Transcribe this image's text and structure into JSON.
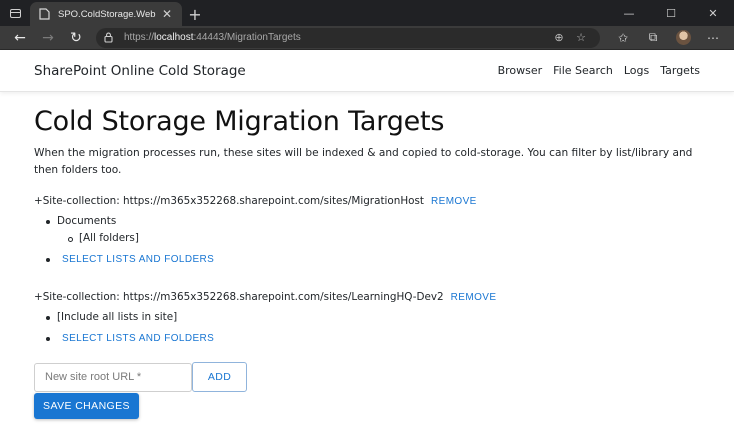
{
  "browser": {
    "tab_title": "SPO.ColdStorage.Web",
    "url_scheme": "https://",
    "url_host": "localhost",
    "url_rest": ":44443/MigrationTargets"
  },
  "navbar": {
    "brand": "SharePoint Online Cold Storage",
    "links": [
      "Browser",
      "File Search",
      "Logs",
      "Targets"
    ]
  },
  "page": {
    "title": "Cold Storage Migration Targets",
    "intro": "When the migration processes run, these sites will be indexed & and copied to cold-storage. You can filter by list/library and then folders too."
  },
  "sites": [
    {
      "label": "+Site-collection: https://m365x352268.sharepoint.com/sites/MigrationHost",
      "remove_label": "REMOVE",
      "list": "Documents",
      "folder": "[All folders]",
      "select_label": "SELECT LISTS AND FOLDERS"
    },
    {
      "label": "+Site-collection: https://m365x352268.sharepoint.com/sites/LearningHQ-Dev2",
      "remove_label": "REMOVE",
      "list": "[Include all lists in site]",
      "select_label": "SELECT LISTS AND FOLDERS"
    }
  ],
  "form": {
    "url_placeholder": "New site root URL *",
    "add_label": "ADD",
    "save_label": "SAVE CHANGES"
  },
  "colors": {
    "accent": "#1976d2",
    "chrome_dark": "#202124"
  }
}
